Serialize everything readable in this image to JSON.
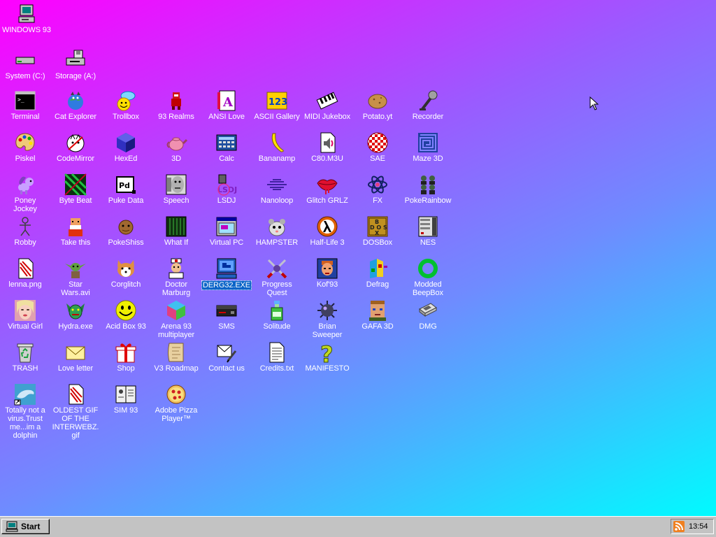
{
  "desktop": {
    "icons": {
      "windows93": "WINDOWS 93",
      "system_c": "System (C:)",
      "storage_a": "Storage (A:)",
      "terminal": "Terminal",
      "cat_explorer": "Cat Explorer",
      "trollbox": "Trollbox",
      "realms93": "93 Realms",
      "ansi_love": "ANSI Love",
      "ascii_gallery": "ASCII Gallery",
      "midi_jukebox": "MIDI Jukebox",
      "potato_yt": "Potato.yt",
      "recorder": "Recorder",
      "piskel": "Piskel",
      "codemirror": "CodeMirror",
      "hexed": "HexEd",
      "three_d": "3D",
      "calc": "Calc",
      "bananamp": "Bananamp",
      "c80_m3u": "C80.M3U",
      "sae": "SAE",
      "maze_3d": "Maze 3D",
      "poney_jockey": "Poney\nJockey",
      "byte_beat": "Byte Beat",
      "puke_data": "Puke Data",
      "speech": "Speech",
      "lsdj": "LSDJ",
      "nanoloop": "Nanoloop",
      "glitch_grlz": "Glitch GRLZ",
      "fx": "FX",
      "pokerainbow": "PokeRainbow",
      "robby": "Robby",
      "take_this": "Take this",
      "pokeshiss": "PokeShiss",
      "what_if": "What If",
      "virtual_pc": "Virtual PC",
      "hampster": "HAMPSTER",
      "half_life_3": "Half-Life 3",
      "dosbox": "DOSBox",
      "nes": "NES",
      "lenna_png": "lenna.png",
      "star_wars_avi": "Star\nWars.avi",
      "corglitch": "Corglitch",
      "doctor_marburg": "Doctor\nMarburg",
      "derg32_exe": "DERG32.EXE",
      "progress_quest": "Progress\nQuest",
      "kof93": "Kof'93",
      "defrag": "Defrag",
      "modded_beepbox": "Modded\nBeepBox",
      "virtual_girl": "Virtual Girl",
      "hydra_exe": "Hydra.exe",
      "acid_box_93": "Acid Box 93",
      "arena_93": "Arena 93\nmultiplayer",
      "sms": "SMS",
      "solitude": "Solitude",
      "brian_sweeper": "Brian\nSweeper",
      "gafa_3d": "GAFA 3D",
      "dmg": "DMG",
      "trash": "TRASH",
      "love_letter": "Love letter",
      "shop": "Shop",
      "v3_roadmap": "V3 Roadmap",
      "contact_us": "Contact us",
      "credits_txt": "Credits.txt",
      "manifesto": "MANIFESTO",
      "dolphin": "Totally not a\nvirus.Trust\nme...im a\ndolphin",
      "oldest_gif": "OLDEST GIF\nOF THE\nINTERWEBZ.\ngif",
      "sim93": "SIM 93",
      "adobe_pizza": "Adobe Pizza\nPlayer™"
    }
  },
  "taskbar": {
    "start_label": "Start",
    "clock": "13:54"
  },
  "colors": {
    "gradient_start": "#ff00ff",
    "gradient_end": "#00fbff",
    "taskbar": "#c3c3c3",
    "selection": "#0a64c8"
  }
}
